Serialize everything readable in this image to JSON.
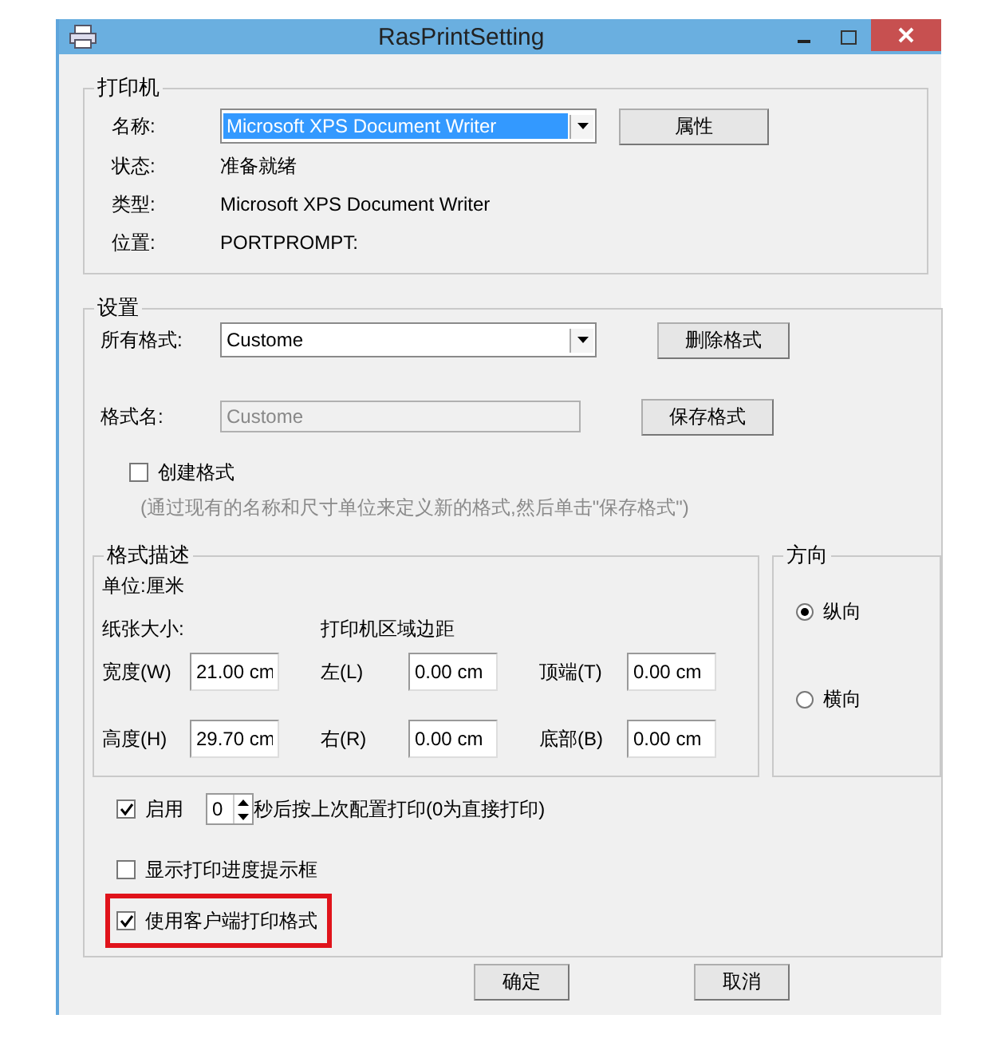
{
  "window": {
    "title": "RasPrintSetting"
  },
  "printer": {
    "title": "打印机",
    "name_label": "名称:",
    "name_value": "Microsoft XPS Document Writer",
    "properties_button": "属性",
    "info": [
      {
        "label": "状态:",
        "value": "准备就绪"
      },
      {
        "label": "类型:",
        "value": "Microsoft XPS Document Writer"
      },
      {
        "label": "位置:",
        "value": "PORTPROMPT:"
      }
    ]
  },
  "settings": {
    "title": "设置",
    "all_formats": {
      "label": "所有格式:",
      "value": "Custome"
    },
    "delete_button": "删除格式",
    "format_name": {
      "label": "格式名:",
      "value": "Custome",
      "disabled": true
    },
    "save_button": "保存格式",
    "create_format": {
      "label": "创建格式",
      "checked": false
    },
    "hint": "(通过现有的名称和尺寸单位来定义新的格式,然后单击\"保存格式\")",
    "description": {
      "title": "格式描述",
      "unit": "单位:厘米",
      "paper_size": "纸张大小:",
      "margins_title": "打印机区域边距",
      "rows": [
        [
          {
            "label": "宽度(W)",
            "value": "21.00 cm"
          },
          {
            "label": "左(L)",
            "value": "0.00 cm"
          },
          {
            "label": "顶端(T)",
            "value": "0.00 cm"
          }
        ],
        [
          {
            "label": "高度(H)",
            "value": "29.70 cm"
          },
          {
            "label": "右(R)",
            "value": "0.00 cm"
          },
          {
            "label": "底部(B)",
            "value": "0.00 cm"
          }
        ]
      ]
    },
    "orientation": {
      "title": "方向",
      "options": [
        {
          "label": "纵向",
          "selected": true
        },
        {
          "label": "横向",
          "selected": false
        }
      ]
    },
    "options": [
      {
        "kind": "delay",
        "label": "启用",
        "checked": true,
        "highlighted": false,
        "spin_value": "0",
        "suffix": "秒后按上次配置打印(0为直接打印)"
      },
      {
        "kind": "plain",
        "label": "显示打印进度提示框",
        "checked": false,
        "highlighted": false
      },
      {
        "kind": "plain",
        "label": "使用客户端打印格式",
        "checked": true,
        "highlighted": true
      }
    ]
  },
  "buttons": [
    "确定",
    "取消"
  ]
}
